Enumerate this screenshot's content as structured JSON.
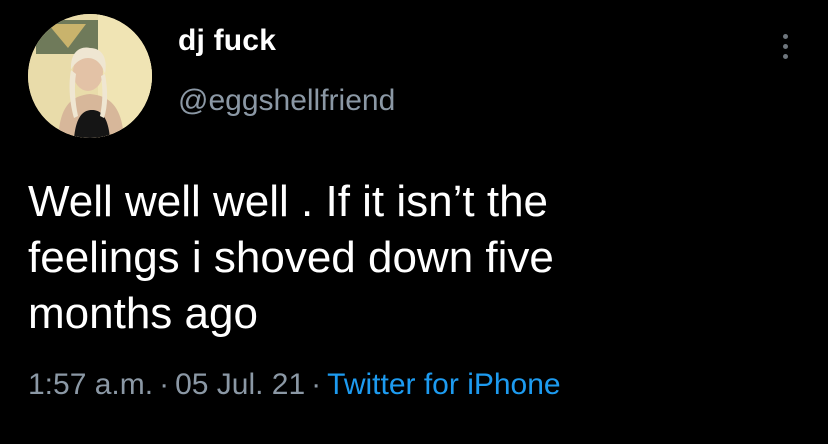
{
  "user": {
    "display_name": "dj fuck",
    "handle": "@eggshellfriend"
  },
  "tweet": {
    "lines": [
      "Well well well . If it isn’t the",
      "feelings i shoved down five",
      "months ago"
    ]
  },
  "meta": {
    "time": "1:57 a.m.",
    "separator": "·",
    "date": "05 Jul. 21",
    "source": "Twitter for iPhone"
  },
  "icons": {
    "more": "more-vertical-icon",
    "avatar": "profile-photo"
  },
  "colors": {
    "background": "#000000",
    "text": "#ffffff",
    "muted": "#8b98a5",
    "link": "#1d9bf0"
  }
}
